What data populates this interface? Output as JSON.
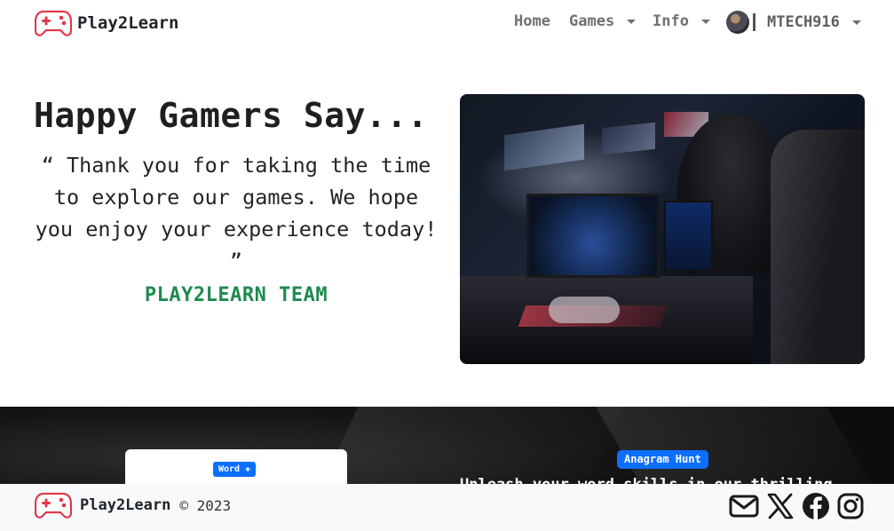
{
  "navbar": {
    "brand": "Play2Learn",
    "home": "Home",
    "games": "Games",
    "info": "Info",
    "username": "MTECH916"
  },
  "hero": {
    "title": "Happy Gamers Say...",
    "quote": "“ Thank you for taking the time to explore our games. We hope you enjoy your experience today! ”",
    "signature": "PLAY2LEARN TEAM"
  },
  "games_section": {
    "word_badge": "Word ✚",
    "anagram_badge": "Anagram Hunt",
    "anagram_text": "Unleash your word skills in our thrilling"
  },
  "footer": {
    "brand": "Play2Learn",
    "copyright": "© 2023",
    "icons": [
      "envelope-icon",
      "x-twitter-icon",
      "facebook-icon",
      "instagram-icon"
    ]
  },
  "colors": {
    "logo_red": "#e0394c",
    "team_green": "#1e8b4f",
    "badge_blue": "#0d6efd",
    "nav_gray": "#707070"
  }
}
